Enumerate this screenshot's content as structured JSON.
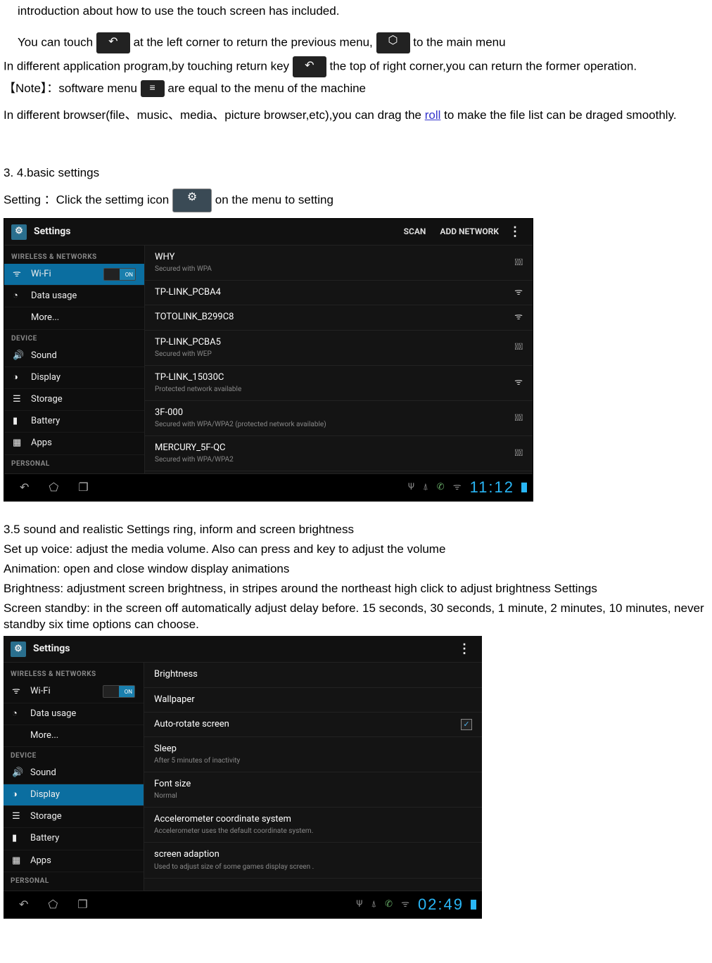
{
  "doc": {
    "p0": "introduction about how to use the touch screen has included.",
    "p1a": "You can touch ",
    "p1b": "at the left corner to return the previous menu, ",
    "p1c": " to the main menu",
    "p2a": "In different application program,by touching return key",
    "p2b": " the top of right corner,you can return the former operation.",
    "p3a": "【Note】：software menu",
    "p3b": "are equal to the menu of the machine",
    "p4a": "In different browser(file、music、media、picture browser,etc),you can drag the ",
    "p4link": "roll",
    "p4b": " to make the file list can be draged smoothly.",
    "sec34": "3. 4.basic settings",
    "setting_a": "Setting  ：Click the settimg icon",
    "setting_b": " on the menu to setting",
    "sec35": "3.5 sound and realistic Settings ring, inform and screen brightness",
    "l1": "Set up voice: adjust the media volume. Also can press and key to adjust the volume",
    "l2": "Animation: open and close window display animations",
    "l3": "Brightness: adjustment screen brightness, in stripes around the northeast high click to adjust brightness Settings",
    "l4": "Screen standby: in the screen off automatically adjust delay before. 15 seconds, 30 seconds, 1 minute, 2 minutes, 10 minutes, never standby six time options can choose."
  },
  "shot1": {
    "title": "Settings",
    "scan": "SCAN",
    "addnetwork": "ADD NETWORK",
    "sidebar": {
      "grp1": "WIRELESS & NETWORKS",
      "wifi": "Wi-Fi",
      "data": "Data usage",
      "more": "More...",
      "grp2": "DEVICE",
      "sound": "Sound",
      "display": "Display",
      "storage": "Storage",
      "battery": "Battery",
      "apps": "Apps",
      "grp3": "PERSONAL"
    },
    "wifi": [
      {
        "name": "WHY",
        "sub": "Secured with WPA",
        "lock": true
      },
      {
        "name": "TP-LINK_PCBA4",
        "sub": "",
        "lock": false
      },
      {
        "name": "TOTOLINK_B299C8",
        "sub": "",
        "lock": false
      },
      {
        "name": "TP-LINK_PCBA5",
        "sub": "Secured with WEP",
        "lock": true
      },
      {
        "name": "TP-LINK_15030C",
        "sub": "Protected network available",
        "lock": false
      },
      {
        "name": "3F-000",
        "sub": "Secured with WPA/WPA2 (protected network available)",
        "lock": true
      },
      {
        "name": "MERCURY_5F-QC",
        "sub": "Secured with WPA/WPA2",
        "lock": true
      }
    ],
    "clock": "11:12"
  },
  "shot2": {
    "title": "Settings",
    "sidebar": {
      "grp1": "WIRELESS & NETWORKS",
      "wifi": "Wi-Fi",
      "data": "Data usage",
      "more": "More...",
      "grp2": "DEVICE",
      "sound": "Sound",
      "display": "Display",
      "storage": "Storage",
      "battery": "Battery",
      "apps": "Apps",
      "grp3": "PERSONAL"
    },
    "list": [
      {
        "label": "Brightness",
        "sub": ""
      },
      {
        "label": "Wallpaper",
        "sub": ""
      },
      {
        "label": "Auto-rotate screen",
        "sub": "",
        "checked": true
      },
      {
        "label": "Sleep",
        "sub": "After 5 minutes of inactivity"
      },
      {
        "label": "Font size",
        "sub": "Normal"
      },
      {
        "label": "Accelerometer coordinate system",
        "sub": "Accelerometer uses the default coordinate system."
      },
      {
        "label": "screen adaption",
        "sub": "Used to adjust size of some games display screen ."
      }
    ],
    "clock": "02:49"
  }
}
